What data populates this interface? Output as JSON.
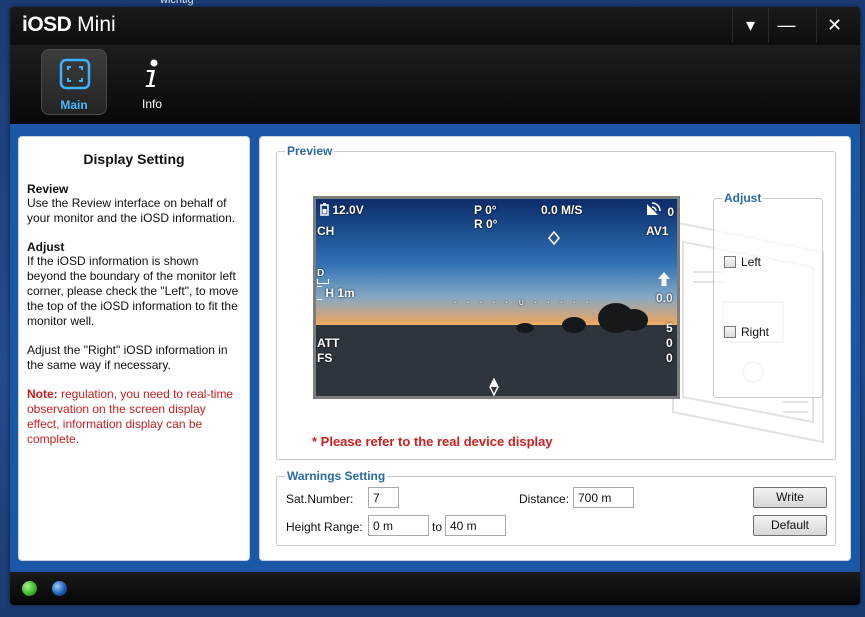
{
  "desktop": {
    "bg_text": "wichtig"
  },
  "app": {
    "title_bold": "iOSD",
    "title_light": " Mini"
  },
  "window_controls": {
    "dropdown": "▾",
    "minimize": "—",
    "close": "✕"
  },
  "toolbar": {
    "tabs": [
      {
        "label": "Main",
        "icon": "main-icon",
        "active": true
      },
      {
        "label": "Info",
        "icon": "info-icon",
        "active": false
      }
    ]
  },
  "left_panel": {
    "title": "Display Setting",
    "review_heading": "Review",
    "review_text": "Use the Review interface on behalf of your monitor and the iOSD information.",
    "adjust_heading": "Adjust",
    "adjust_text": "If the iOSD information is shown beyond the boundary of the monitor left corner, please check the \"Left\", to move the top of the iOSD information to fit the monitor well.",
    "adjust_text2": "Adjust the \"Right\" iOSD information in the same way if necessary.",
    "note_label": "Note:",
    "note_text": " regulation, you need to real-time observation on the screen display effect, information display can be complete."
  },
  "preview": {
    "title": "Preview",
    "osd": {
      "voltage": "12.0V",
      "ch": "CH",
      "pitch": "P 0°",
      "roll": "R 0°",
      "speed": "0.0 M/S",
      "sats": "0",
      "av": "AV1",
      "dist_label": "D",
      "height": "H 1m",
      "vspeed": "0.0",
      "att": "ATT",
      "fs": "FS",
      "val1": "5",
      "val2": "0",
      "val3": "0"
    },
    "refer_note": "* Please refer to the real device display"
  },
  "adjust": {
    "title": "Adjust",
    "left_label": "Left",
    "right_label": "Right",
    "left_checked": false,
    "right_checked": false
  },
  "warnings": {
    "title": "Warnings Setting",
    "sat_label": "Sat.Number:",
    "sat_value": "7",
    "distance_label": "Distance:",
    "distance_value": "700 m",
    "height_label": "Height Range:",
    "height_min": "0 m",
    "to_label": "to",
    "height_max": "40 m",
    "write_label": "Write",
    "default_label": "Default"
  },
  "status": {
    "dot1_color": "#3dbb2a",
    "dot2_color": "#1f5fb5"
  }
}
